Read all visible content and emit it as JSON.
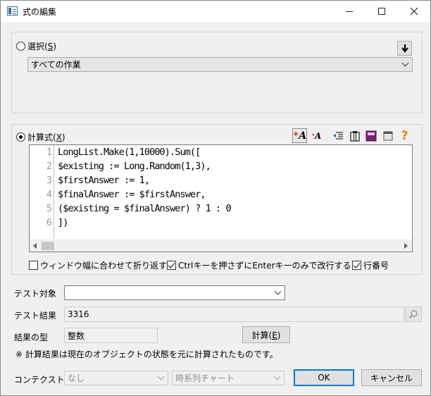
{
  "window": {
    "title": "式の編集"
  },
  "select_group": {
    "radio_label_prefix": "選択(",
    "radio_label_key": "S",
    "radio_label_suffix": ")",
    "combo_value": "すべての作業"
  },
  "formula_group": {
    "radio_label_prefix": "計算式(",
    "radio_label_key": "X",
    "radio_label_suffix": ")",
    "toolbar_icons": [
      "increase-font-icon",
      "decrease-font-icon",
      "indent-icon",
      "column-icon",
      "book-icon",
      "window-icon",
      "help-icon"
    ],
    "code_lines": [
      {
        "num": "1",
        "text": "LongList.Make(1,10000).Sum(["
      },
      {
        "num": "2",
        "text": "$existing := Long.Random(1,3),"
      },
      {
        "num": "3",
        "text": "$firstAnswer := 1,"
      },
      {
        "num": "4",
        "text": "$finalAnswer := $firstAnswer,"
      },
      {
        "num": "5",
        "text": "($existing = $finalAnswer) ? 1 : 0"
      },
      {
        "num": "6",
        "text": "])"
      }
    ],
    "options": {
      "wrap_label": "ウィンドウ幅に合わせて折り返す",
      "wrap_checked": false,
      "ctrl_enter_label": "Ctrlキーを押さずにEnterキーのみで改行する",
      "ctrl_enter_checked": true,
      "line_numbers_label": "行番号",
      "line_numbers_checked": true
    }
  },
  "test": {
    "target_label": "テスト対象",
    "target_value": "",
    "result_label": "テスト結果",
    "result_value": "3316",
    "type_label": "結果の型",
    "type_value": "整数",
    "compute_button_prefix": "計算(",
    "compute_button_key": "E",
    "compute_button_suffix": ")",
    "note": "※ 計算結果は現在のオブジェクトの状態を元に計算されたものです。"
  },
  "context": {
    "label": "コンテクスト",
    "combo1_value": "なし",
    "combo2_value": "時系列チャート"
  },
  "buttons": {
    "ok": "OK",
    "cancel": "キャンセル"
  }
}
